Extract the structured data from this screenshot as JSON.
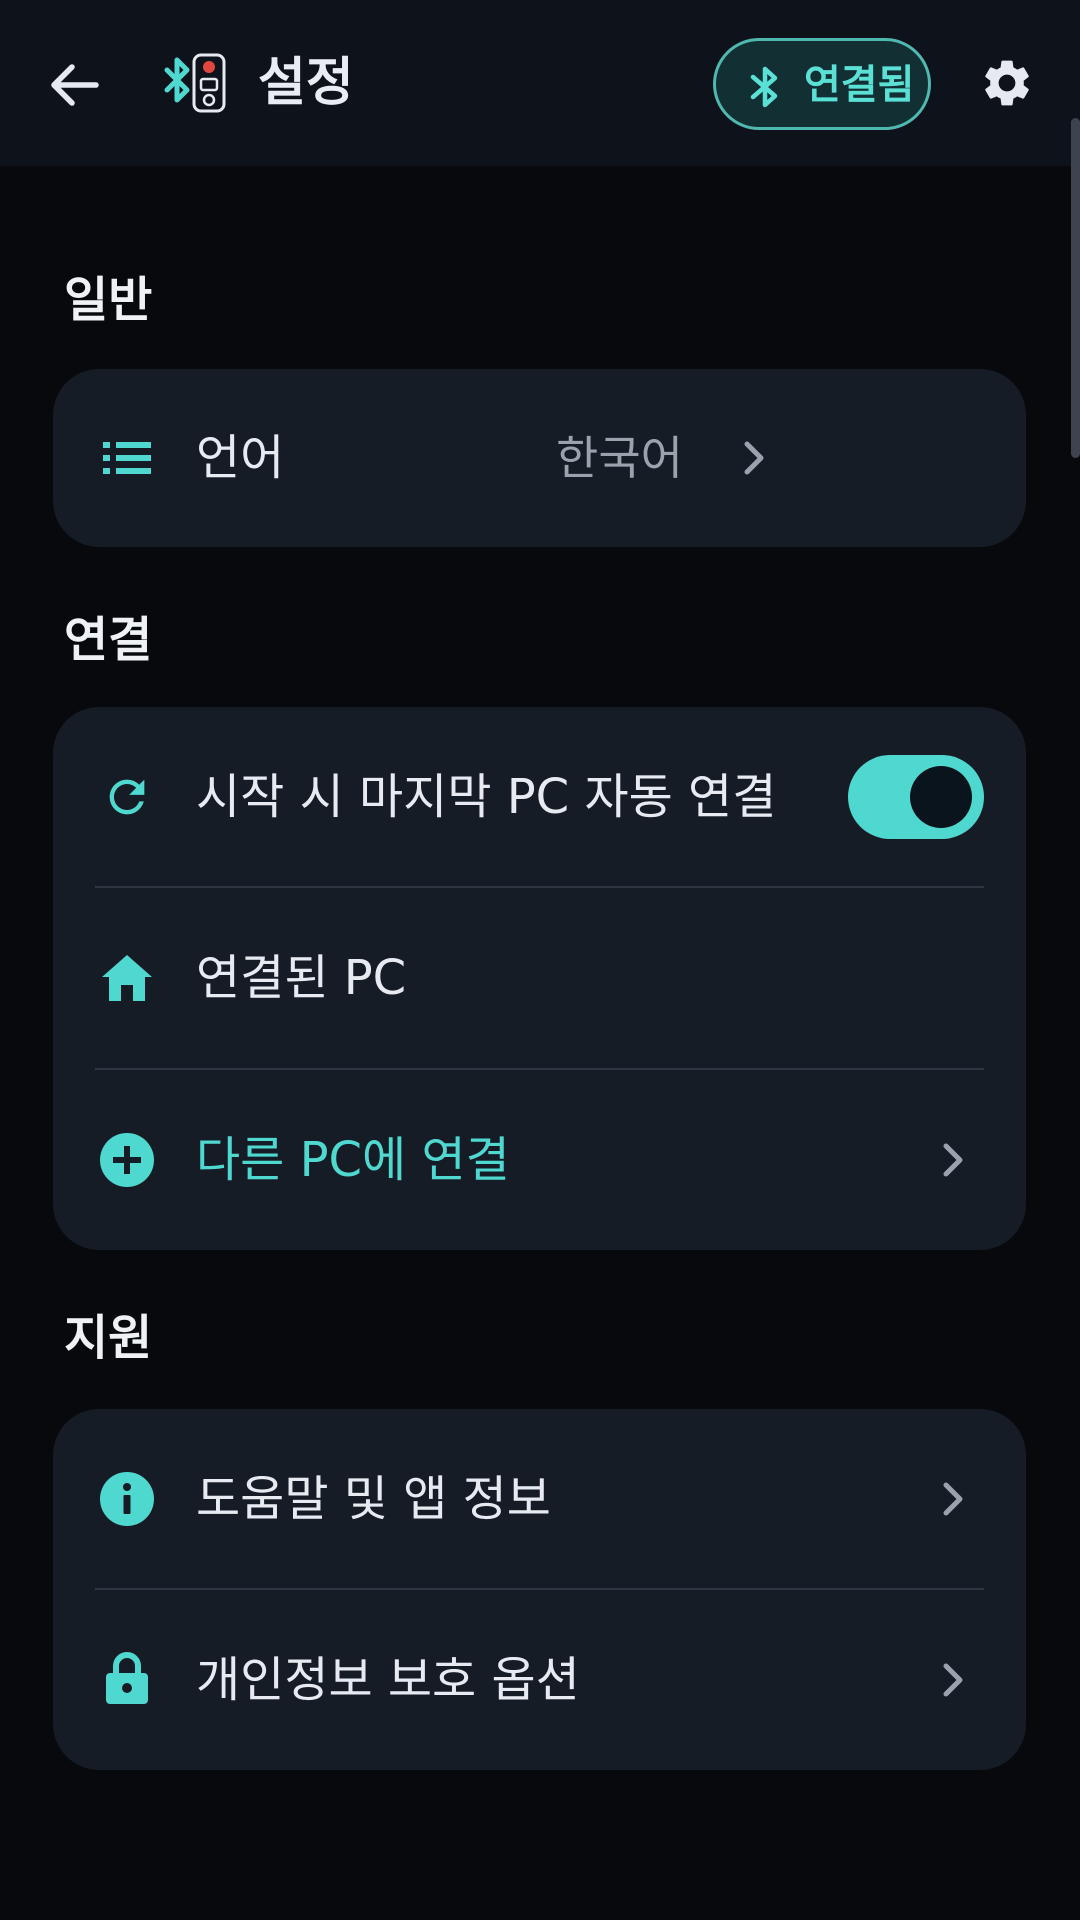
{
  "header": {
    "title": "설정",
    "status_label": "연결됨",
    "icons": {
      "back": "arrow-left-icon",
      "logo": "bluetooth-remote-logo",
      "status": "bluetooth-icon",
      "settings": "gear-icon"
    }
  },
  "sections": {
    "general": {
      "title": "일반",
      "language": {
        "label": "언어",
        "value": "한국어",
        "icon": "list-icon"
      }
    },
    "connection": {
      "title": "연결",
      "auto_connect": {
        "label": "시작 시 마지막 PC 자동 연결",
        "enabled": true,
        "icon": "refresh-icon"
      },
      "connected_pc": {
        "label": "연결된 PC",
        "icon": "home-icon"
      },
      "connect_other": {
        "label": "다른 PC에 연결",
        "icon": "plus-circle-icon"
      }
    },
    "support": {
      "title": "지원",
      "help": {
        "label": "도움말 및 앱 정보",
        "icon": "info-icon"
      },
      "privacy": {
        "label": "개인정보 보호 옵션",
        "icon": "lock-icon"
      }
    }
  },
  "colors": {
    "accent": "#4fd8cf",
    "background": "#07090d",
    "header_bg": "#0e131b",
    "card_bg": "#161c25",
    "text_primary": "#e7ebf1",
    "text_secondary": "#9aa2ad"
  }
}
